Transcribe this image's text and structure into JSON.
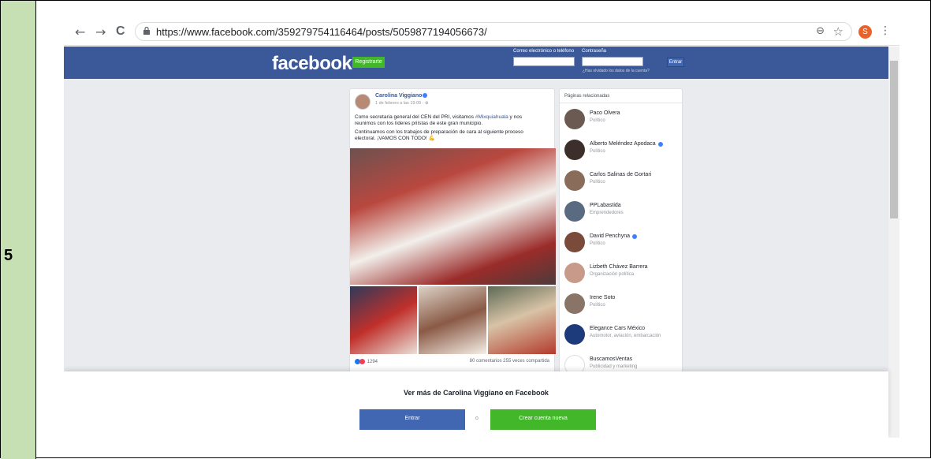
{
  "row_number": "5",
  "browser": {
    "back": "←",
    "forward": "→",
    "reload": "C",
    "url": "https://www.facebook.com/359279754116464/posts/5059877194056673/",
    "zoom_icon": "⊖",
    "star_icon": "☆",
    "profile_initial": "S",
    "menu_icon": "⋮"
  },
  "header": {
    "logo": "facebook",
    "register": "Registrarte",
    "email_label": "Correo electrónico o teléfono",
    "password_label": "Contraseña",
    "login": "Entrar",
    "forgot": "¿Has olvidado los datos de la cuenta?"
  },
  "post": {
    "author": "Carolina Viggiano",
    "date": "1 de febrero a las 19:09 · ⊕",
    "text_line1": "Como secretaria general del CEN del PRI, visitamos",
    "hashtag": "#Mixquiahuala",
    "text_line1b": " y nos",
    "text_line2": "reunimos con los líderes priístas de este gran municipio.",
    "text_line3": "Continuamos con los trabajos de preparación de cara al siguiente proceso",
    "text_line4": "electoral. ¡VAMOS CON TODO! 💪",
    "reaction_count": "1294",
    "stats": "80 comentarios  255 veces compartida"
  },
  "related": {
    "title": "Páginas relacionadas",
    "items": [
      {
        "name": "Paco Olvera",
        "category": "Político",
        "color": "#6b5a52",
        "verified": false
      },
      {
        "name": "Alberto Meléndez Apodaca",
        "category": "Político",
        "color": "#3c2e2b",
        "verified": true
      },
      {
        "name": "Carlos Salinas de Gortari",
        "category": "Político",
        "color": "#8a6c5a",
        "verified": false
      },
      {
        "name": "PPLabastida",
        "category": "Emprendedores",
        "color": "#5a6a80",
        "verified": false
      },
      {
        "name": "David Penchyna",
        "category": "Político",
        "color": "#7a4a3a",
        "verified": true
      },
      {
        "name": "Lizbeth Chávez Barrera",
        "category": "Organización política",
        "color": "#c79a8a",
        "verified": false
      },
      {
        "name": "Irene Soto",
        "category": "Político",
        "color": "#8a7468",
        "verified": false
      },
      {
        "name": "Elegance Cars México",
        "category": "Automotor, aviación, embarcación",
        "color": "#1d3a7a",
        "verified": false
      },
      {
        "name": "BuscamosVentas",
        "category": "Publicidad y marketing",
        "color": "#ffffff",
        "verified": false
      }
    ]
  },
  "banner": {
    "title": "Ver más de Carolina Viggiano en Facebook",
    "login": "Entrar",
    "or": "o",
    "create": "Crear cuenta nueva"
  }
}
